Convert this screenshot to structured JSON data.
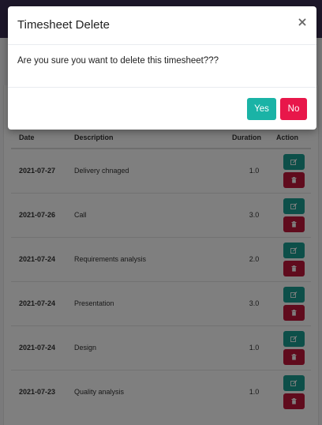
{
  "modal": {
    "title": "Timesheet Delete",
    "close_label": "×",
    "message": "Are you sure you want to delete this timesheet???",
    "yes_label": "Yes",
    "no_label": "No"
  },
  "table": {
    "headers": {
      "date": "Date",
      "description": "Description",
      "duration": "Duration",
      "action": "Action"
    },
    "rows": [
      {
        "date": "2021-07-27",
        "description": "Delivery  chnaged",
        "duration": "1.0"
      },
      {
        "date": "2021-07-26",
        "description": "Call",
        "duration": "3.0"
      },
      {
        "date": "2021-07-24",
        "description": "Requirements analysis",
        "duration": "2.0"
      },
      {
        "date": "2021-07-24",
        "description": "Presentation",
        "duration": "3.0"
      },
      {
        "date": "2021-07-24",
        "description": "Design",
        "duration": "1.0"
      },
      {
        "date": "2021-07-23",
        "description": "Quality analysis",
        "duration": "1.0"
      }
    ],
    "action_icons": {
      "edit": "edit-icon",
      "delete": "trash-icon"
    }
  },
  "colors": {
    "edit_button": "#1a9f93",
    "delete_button": "#c1163b",
    "yes_button": "#1ab3a6",
    "no_button": "#e8174a"
  }
}
